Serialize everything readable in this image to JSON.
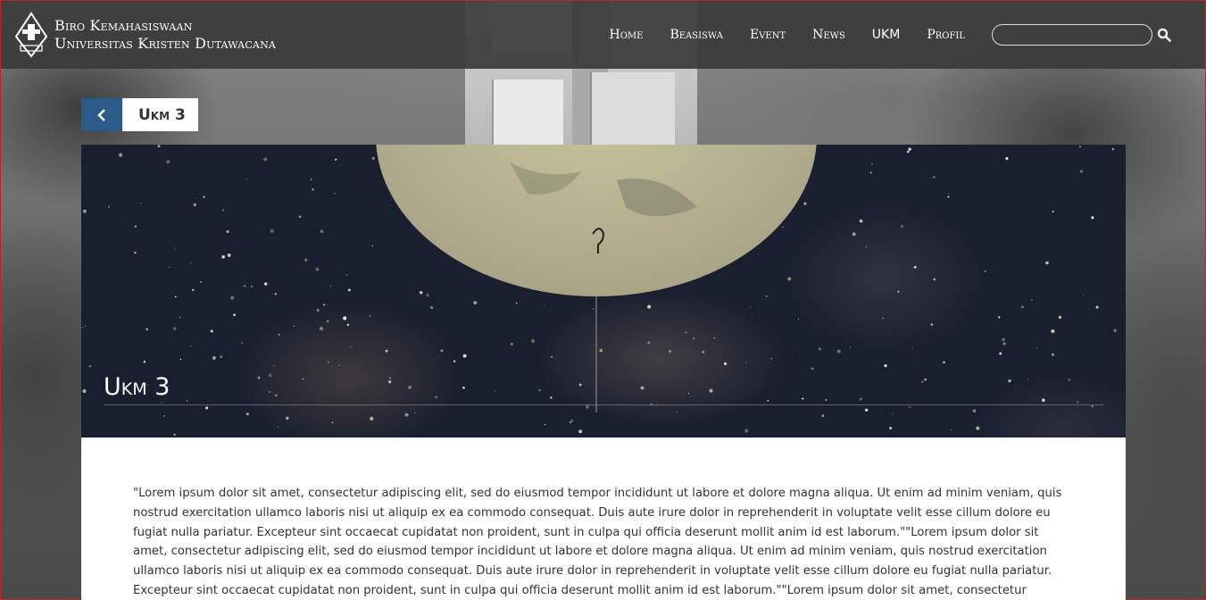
{
  "brand": {
    "line1": "Biro Kemahasiswaan",
    "line2": "Universitas Kristen Dutawacana"
  },
  "nav": {
    "items": [
      {
        "label": "Home"
      },
      {
        "label": "Beasiswa"
      },
      {
        "label": "Event"
      },
      {
        "label": "News"
      },
      {
        "label": "UKM"
      },
      {
        "label": "Profil"
      }
    ]
  },
  "search": {
    "value": "",
    "placeholder": ""
  },
  "breadcrumb": {
    "back_icon": "chevron-left-icon",
    "title": "Ukm 3"
  },
  "hero": {
    "title": "Ukm 3"
  },
  "content": {
    "text": "\"Lorem ipsum dolor sit amet, consectetur adipiscing elit, sed do eiusmod tempor incididunt ut labore et dolore magna aliqua. Ut enim ad minim veniam, quis nostrud exercitation ullamco laboris nisi ut aliquip ex ea commodo consequat. Duis aute irure dolor in reprehenderit in voluptate velit esse cillum dolore eu fugiat nulla pariatur. Excepteur sint occaecat cupidatat non proident, sunt in culpa qui officia deserunt mollit anim id est laborum.\"\"Lorem ipsum dolor sit amet, consectetur adipiscing elit, sed do eiusmod tempor incididunt ut labore et dolore magna aliqua. Ut enim ad minim veniam, quis nostrud exercitation ullamco laboris nisi ut aliquip ex ea commodo consequat. Duis aute irure dolor in reprehenderit in voluptate velit esse cillum dolore eu fugiat nulla pariatur. Excepteur sint occaecat cupidatat non proident, sunt in culpa qui officia deserunt mollit anim id est laborum.\"\"Lorem ipsum dolor sit amet, consectetur adipiscing elit, sed"
  },
  "colors": {
    "accent": "#2b5a8a",
    "navbar": "#3a3a3a",
    "hero_bg": "#1a1f30"
  }
}
